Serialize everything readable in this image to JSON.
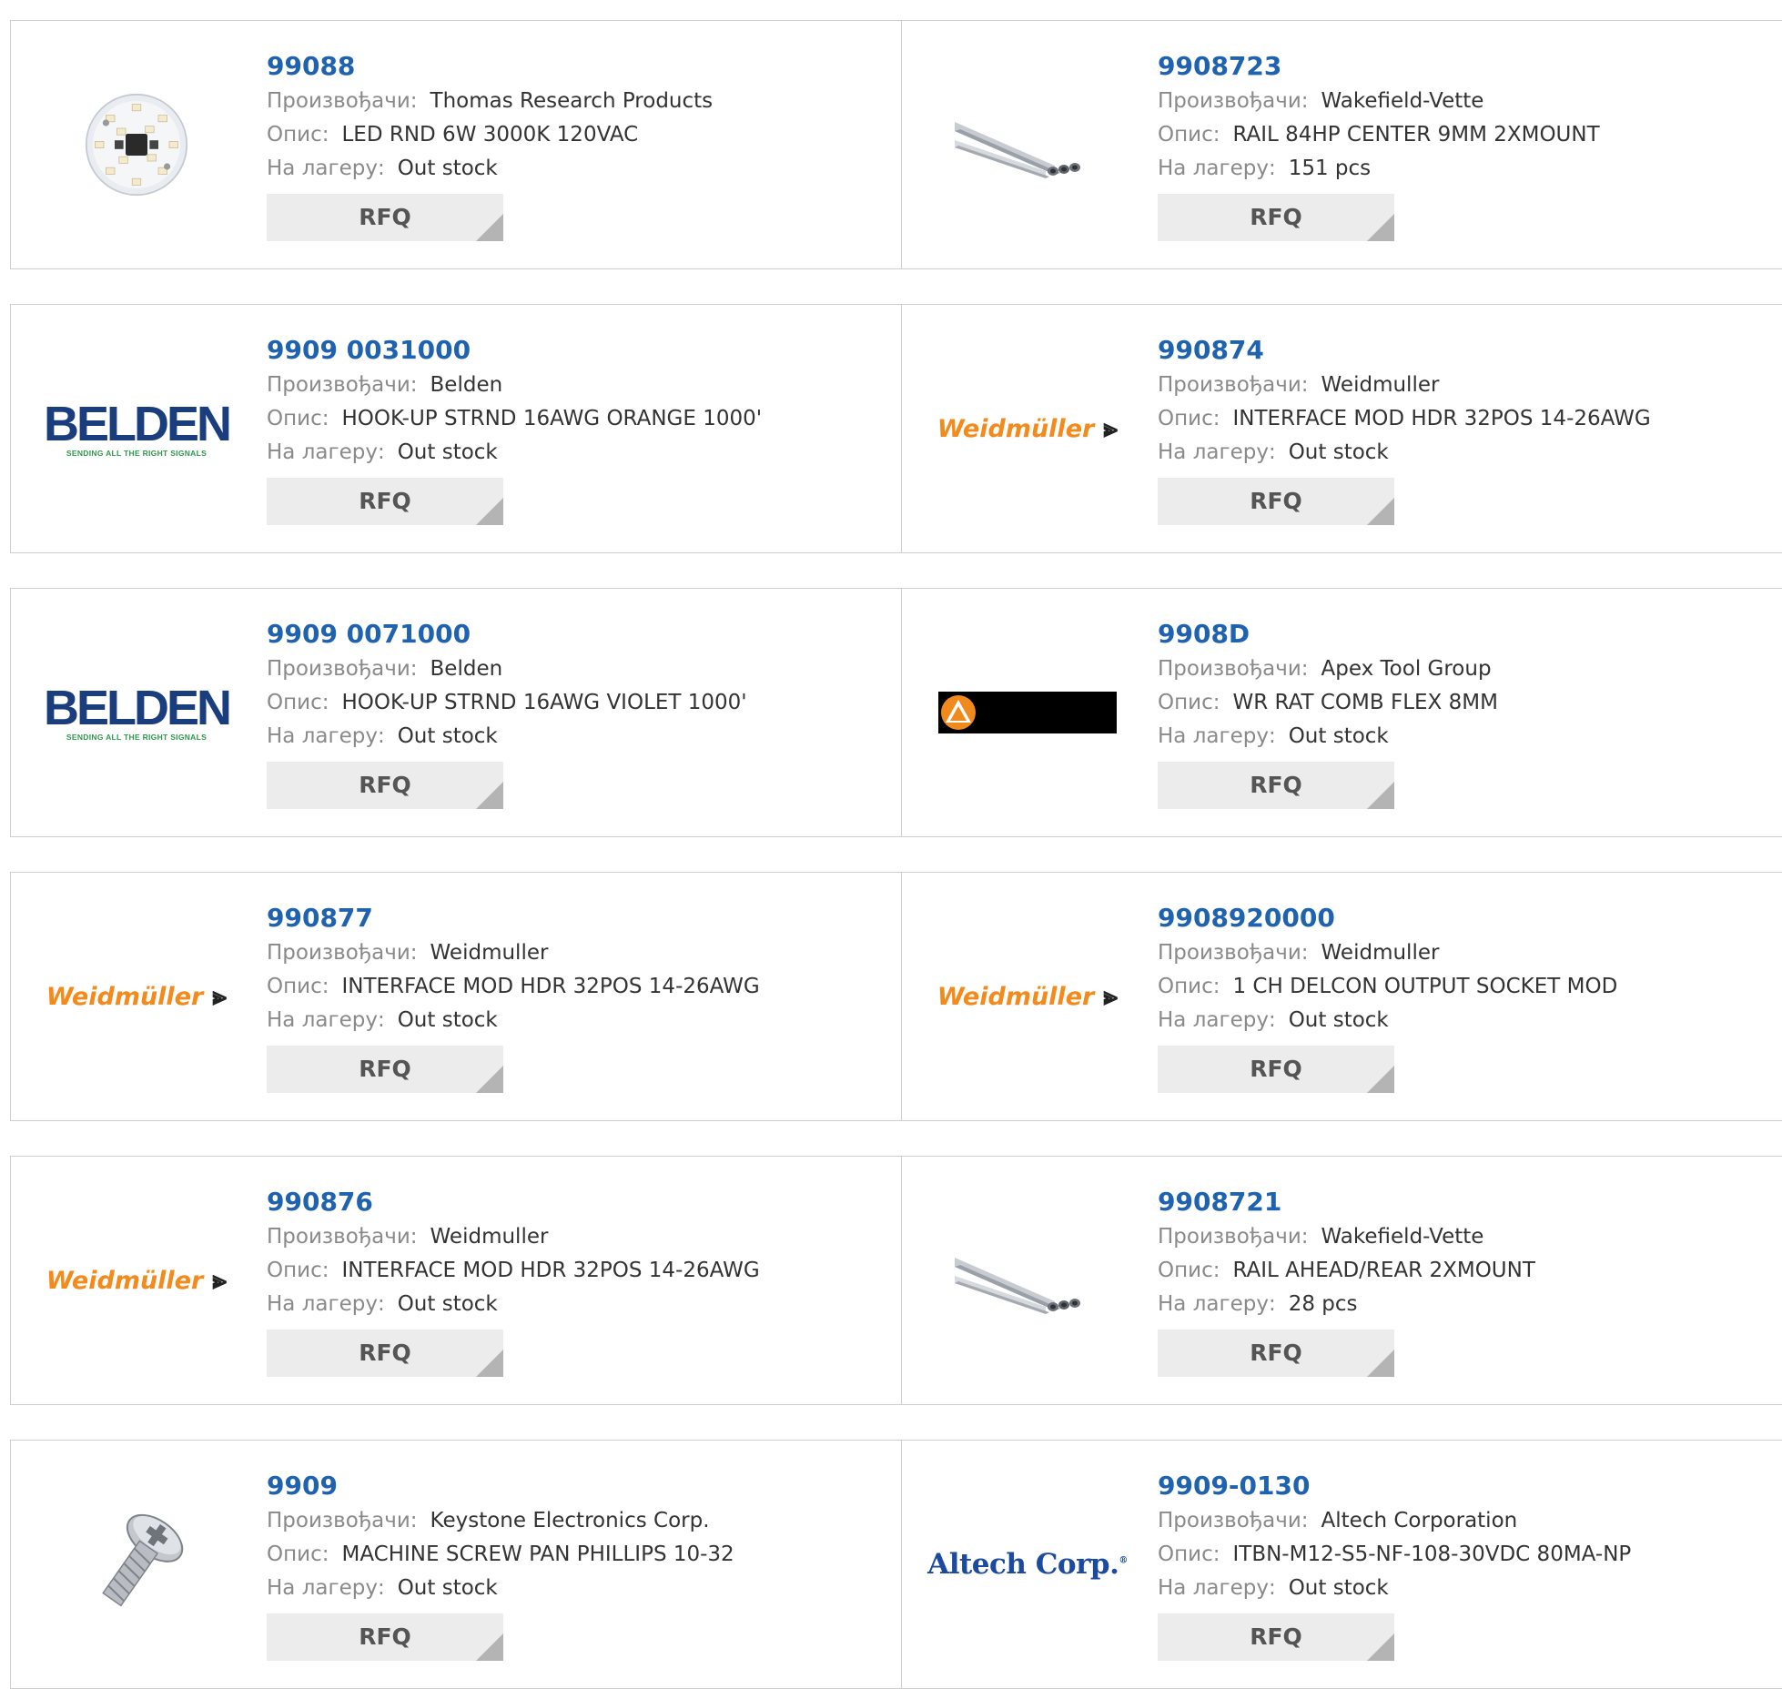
{
  "labels": {
    "manufacturer": "Произвођачи:",
    "description": "Опис:",
    "stock": "На лагеру:",
    "rfq": "RFQ"
  },
  "rows": [
    [
      {
        "part": "99088",
        "manufacturer": "Thomas Research Products",
        "description": "LED RND 6W 3000K 120VAC",
        "stock": "Out stock",
        "image": "led-module-image"
      },
      {
        "part": "9908723",
        "manufacturer": "Wakefield-Vette",
        "description": "RAIL 84HP CENTER 9MM 2XMOUNT",
        "stock": "151 pcs",
        "image": "rail-image"
      }
    ],
    [
      {
        "part": "9909 0031000",
        "manufacturer": "Belden",
        "description": "HOOK-UP STRND 16AWG ORANGE 1000'",
        "stock": "Out stock",
        "image": "belden-logo",
        "logo_name": "BELDEN",
        "logo_tagline": "SENDING ALL THE RIGHT SIGNALS"
      },
      {
        "part": "990874",
        "manufacturer": "Weidmuller",
        "description": "INTERFACE MOD HDR 32POS 14-26AWG",
        "stock": "Out stock",
        "image": "weidmuller-logo",
        "logo_name": "Weidmüller"
      }
    ],
    [
      {
        "part": "9909 0071000",
        "manufacturer": "Belden",
        "description": "HOOK-UP STRND 16AWG VIOLET 1000'",
        "stock": "Out stock",
        "image": "belden-logo",
        "logo_name": "BELDEN",
        "logo_tagline": "SENDING ALL THE RIGHT SIGNALS"
      },
      {
        "part": "9908D",
        "manufacturer": "Apex Tool Group",
        "description": "WR RAT COMB FLEX 8MM",
        "stock": "Out stock",
        "image": "apex-logo"
      }
    ],
    [
      {
        "part": "990877",
        "manufacturer": "Weidmuller",
        "description": "INTERFACE MOD HDR 32POS 14-26AWG",
        "stock": "Out stock",
        "image": "weidmuller-logo",
        "logo_name": "Weidmüller"
      },
      {
        "part": "9908920000",
        "manufacturer": "Weidmuller",
        "description": "1 CH DELCON OUTPUT SOCKET MOD",
        "stock": "Out stock",
        "image": "weidmuller-logo",
        "logo_name": "Weidmüller"
      }
    ],
    [
      {
        "part": "990876",
        "manufacturer": "Weidmuller",
        "description": "INTERFACE MOD HDR 32POS 14-26AWG",
        "stock": "Out stock",
        "image": "weidmuller-logo",
        "logo_name": "Weidmüller"
      },
      {
        "part": "9908721",
        "manufacturer": "Wakefield-Vette",
        "description": "RAIL AHEAD/REAR 2XMOUNT",
        "stock": "28 pcs",
        "image": "rail-image"
      }
    ],
    [
      {
        "part": "9909",
        "manufacturer": "Keystone Electronics Corp.",
        "description": "MACHINE SCREW PAN PHILLIPS 10-32",
        "stock": "Out stock",
        "image": "screw-image"
      },
      {
        "part": "9909-0130",
        "manufacturer": "Altech Corporation",
        "description": "ITBN-M12-S5-NF-108-30VDC 80MA-NP",
        "stock": "Out stock",
        "image": "altech-logo",
        "logo_name": "Altech Corp."
      }
    ]
  ],
  "colors": {
    "link": "#1e62b0",
    "label": "#8a8a8a",
    "value": "#333333",
    "border": "#cfcfcf",
    "button_bg": "#ececec",
    "weidmuller": "#f28a1c",
    "belden": "#1a3d7e"
  }
}
